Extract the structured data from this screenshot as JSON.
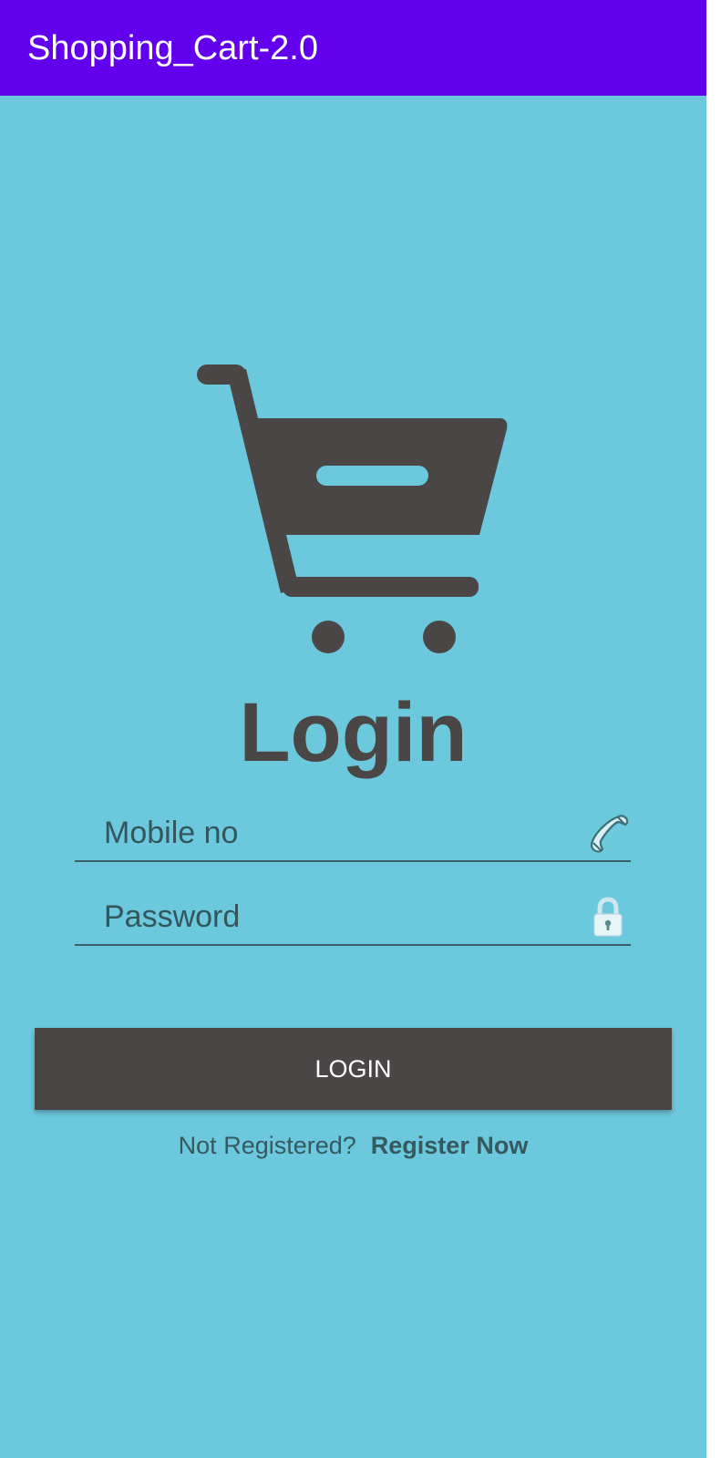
{
  "app_bar": {
    "title": "Shopping_Cart-2.0",
    "color": "#6200ee"
  },
  "background_color": "#6cc8dc",
  "logo": {
    "icon": "shopping-cart-icon",
    "color": "#4a4646"
  },
  "heading": "Login",
  "form": {
    "mobile": {
      "placeholder": "Mobile no",
      "value": "",
      "icon": "phone-icon"
    },
    "password": {
      "placeholder": "Password",
      "value": "",
      "icon": "lock-icon"
    }
  },
  "login_button": {
    "label": "LOGIN",
    "color": "#4a4646"
  },
  "register": {
    "prompt": "Not Registered?",
    "link_label": "Register Now"
  }
}
